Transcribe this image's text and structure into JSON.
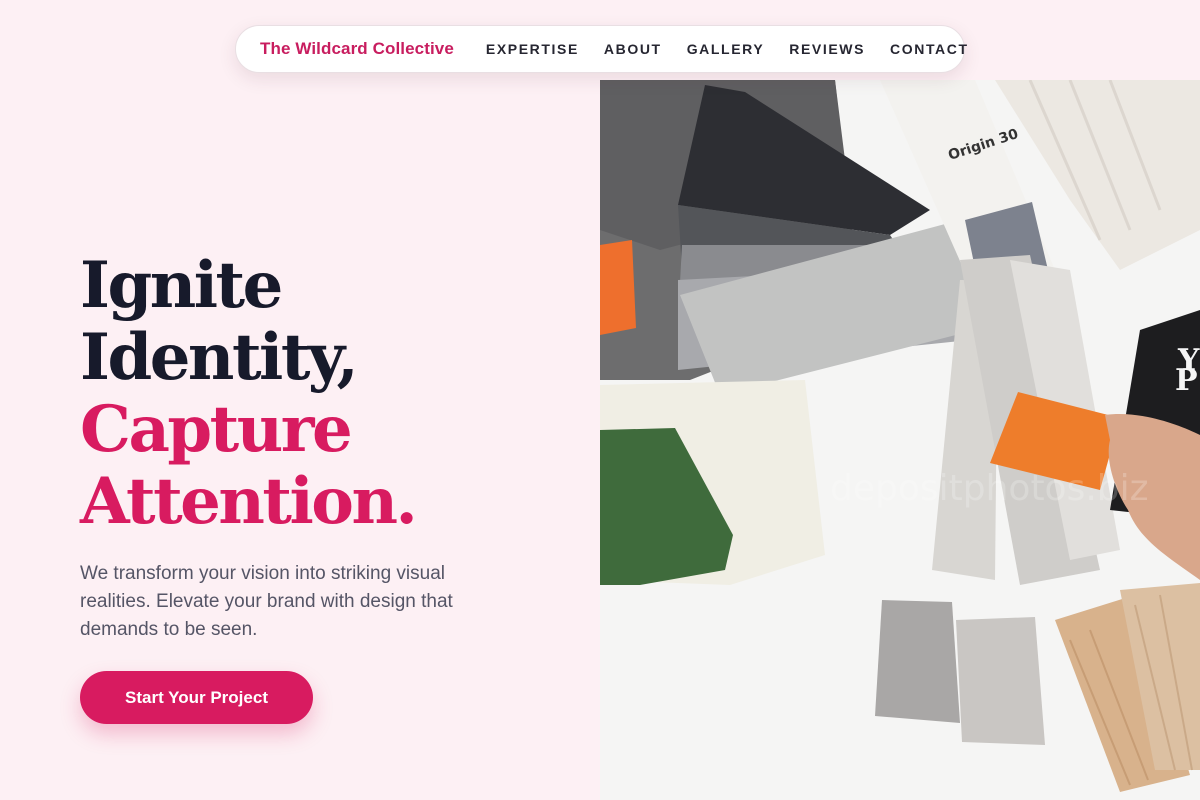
{
  "nav": {
    "brand": "The Wildcard Collective",
    "links": [
      "EXPERTISE",
      "ABOUT",
      "GALLERY",
      "REVIEWS",
      "CONTACT"
    ]
  },
  "hero": {
    "headline_line1": "Ignite",
    "headline_line2": "Identity,",
    "headline_line3": "Capture",
    "headline_line4": "Attention.",
    "subtext": "We transform your vision into striking visual realities. Elevate your brand with design that demands to be seen.",
    "cta_label": "Start Your Project"
  },
  "image": {
    "sample_label": "Origin 30",
    "watermark": "depositphotos.biz"
  },
  "colors": {
    "accent": "#d81b60",
    "brand": "#c81d5f",
    "background": "#fdf0f4",
    "headline_dark": "#171a2b"
  }
}
